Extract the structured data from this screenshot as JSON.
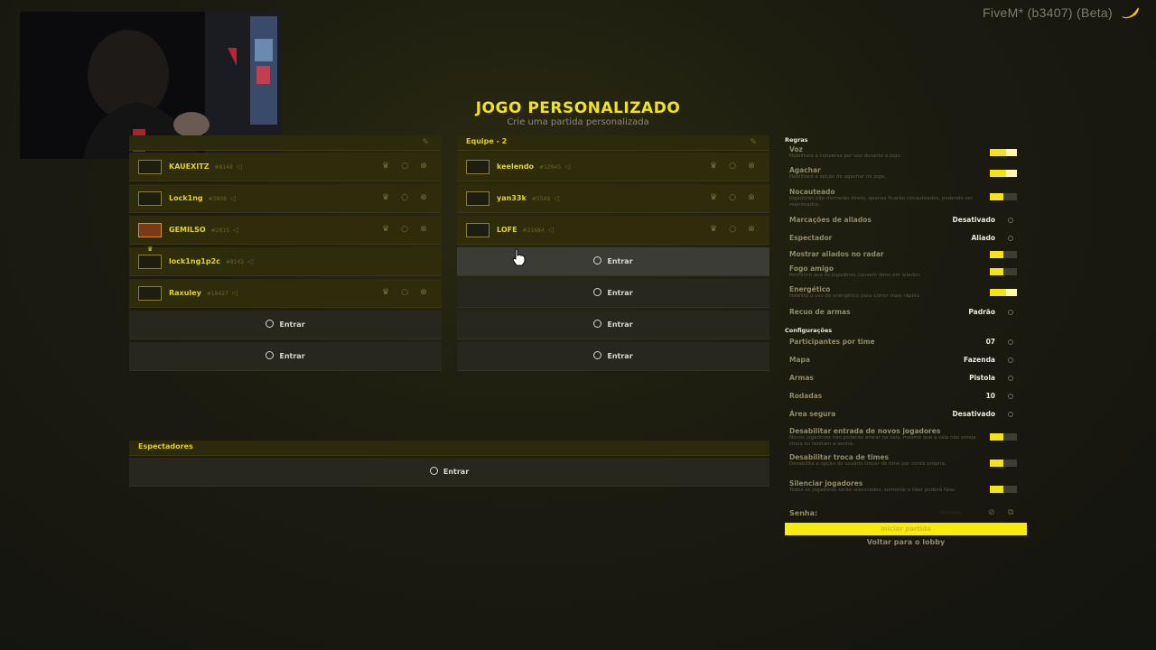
{
  "app": {
    "brand": "FiveM* (b3407) (Beta)",
    "brand_icon": "banana-icon"
  },
  "header": {
    "title": "JOGO PERSONALIZADO",
    "subtitle": "Crie uma partida personalizada"
  },
  "team1": {
    "label": "",
    "players": [
      {
        "name": "KAUEXITZ",
        "id": "#8148"
      },
      {
        "name": "Lock1ng",
        "id": "#3808"
      },
      {
        "name": "GEMILSO",
        "id": "#2815"
      },
      {
        "name": "lock1ng1p2c",
        "id": "#8142"
      },
      {
        "name": "Raxuley",
        "id": "#18427"
      }
    ],
    "enter_labels": [
      "Entrar",
      "Entrar"
    ]
  },
  "team2": {
    "label": "Equipe - 2",
    "players": [
      {
        "name": "keelendo",
        "id": "#12945"
      },
      {
        "name": "yan33k",
        "id": "#5549"
      },
      {
        "name": "LOFE",
        "id": "#31684"
      }
    ],
    "enter_labels": [
      "Entrar",
      "Entrar",
      "Entrar",
      "Entrar"
    ]
  },
  "spectators": {
    "label": "Espectadores",
    "enter_label": "Entrar"
  },
  "rules": {
    "section": "Regras",
    "voz": {
      "label": "Voz",
      "desc": "Habilitará a conversa por voz durante o jogo.",
      "on": true
    },
    "agachar": {
      "label": "Agachar",
      "desc": "Habilitará a opção de agachar no jogo.",
      "on": true
    },
    "nocauteado": {
      "label": "Nocauteado",
      "desc": "Jogadores não morrerão direto, apenas ficarão nocauteados, podendo ser reanimados.",
      "on": true
    },
    "marcacoes": {
      "label": "Marcações de aliados",
      "value": "Desativado"
    },
    "espectador": {
      "label": "Espectador",
      "value": "Aliado"
    },
    "radar": {
      "label": "Mostrar aliados no radar",
      "on": true
    },
    "fogo": {
      "label": "Fogo amigo",
      "desc": "Permitirá que os jogadores causem dano em aliados.",
      "on": true
    },
    "energetico": {
      "label": "Energético",
      "desc": "Habilita o uso de energético para correr mais rápido.",
      "on": true
    },
    "recuo": {
      "label": "Recuo de armas",
      "value": "Padrão"
    }
  },
  "config": {
    "section": "Configurações",
    "participantes": {
      "label": "Participantes por time",
      "value": "07"
    },
    "mapa": {
      "label": "Mapa",
      "value": "Fazenda"
    },
    "armas": {
      "label": "Armas",
      "value": "Pistola"
    },
    "rodadas": {
      "label": "Rodadas",
      "value": "10"
    },
    "area": {
      "label": "Área segura",
      "value": "Desativado"
    },
    "desab_entrada": {
      "label": "Desabilitar entrada de novos jogadores",
      "desc": "Novos jogadores não poderão entrar na sala, mesmo que a sala não esteja cheia ou tenham a senha.",
      "on": true
    },
    "desab_troca": {
      "label": "Desabilitar troca de times",
      "desc": "Desabilita a opção do usuário trocar de time por conta própria.",
      "on": true
    },
    "silenciar": {
      "label": "Silenciar jogadores",
      "desc": "Todos os jogadores serão silenciados, somente o líder poderá falar.",
      "on": true
    }
  },
  "password": {
    "label": "Senha:",
    "value": "•••••••"
  },
  "actions": {
    "start": "Iniciar partida",
    "back": "Voltar para o lobby"
  }
}
